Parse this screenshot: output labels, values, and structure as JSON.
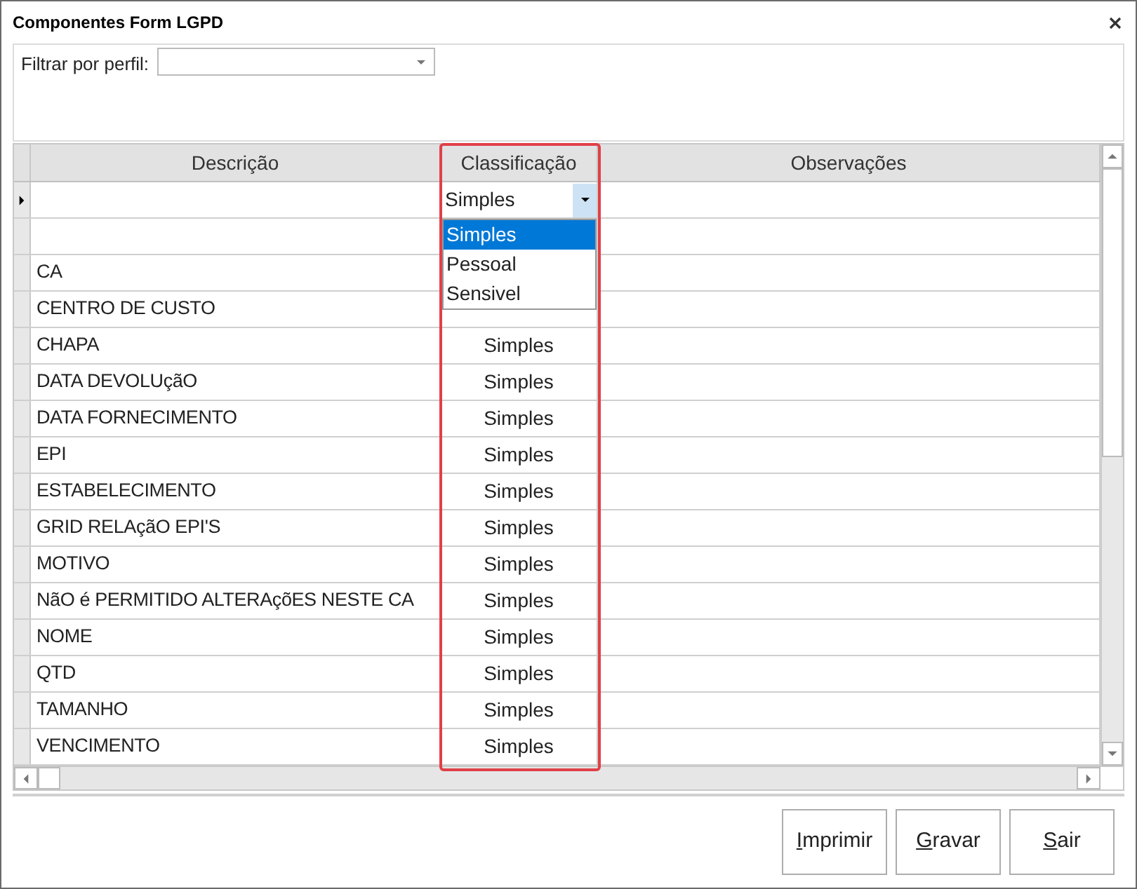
{
  "window": {
    "title": "Componentes Form LGPD"
  },
  "filter": {
    "label": "Filtrar por perfil:"
  },
  "grid": {
    "columns": [
      "Descrição",
      "Classificação",
      "Observações"
    ],
    "editor": {
      "value": "Simples",
      "expanded": true,
      "options": [
        {
          "label": "Simples",
          "selected": true
        },
        {
          "label": "Pessoal",
          "selected": false
        },
        {
          "label": "Sensivel",
          "selected": false
        }
      ]
    },
    "rows": [
      {
        "current": true
      },
      {
        "current": false
      },
      {
        "current": false,
        "descricao": "CA"
      },
      {
        "current": false,
        "descricao": "CENTRO DE CUSTO"
      },
      {
        "current": false,
        "descricao": "CHAPA",
        "classificacao": "Simples"
      },
      {
        "current": false,
        "descricao": "DATA DEVOLUçãO",
        "classificacao": "Simples"
      },
      {
        "current": false,
        "descricao": "DATA FORNECIMENTO",
        "classificacao": "Simples"
      },
      {
        "current": false,
        "descricao": "EPI",
        "classificacao": "Simples"
      },
      {
        "current": false,
        "descricao": "ESTABELECIMENTO",
        "classificacao": "Simples"
      },
      {
        "current": false,
        "descricao": "GRID RELAçãO EPI'S",
        "classificacao": "Simples"
      },
      {
        "current": false,
        "descricao": "MOTIVO",
        "classificacao": "Simples"
      },
      {
        "current": false,
        "descricao": "NãO é PERMITIDO ALTERAçõES NESTE CA",
        "classificacao": "Simples"
      },
      {
        "current": false,
        "descricao": "NOME",
        "classificacao": "Simples"
      },
      {
        "current": false,
        "descricao": "QTD",
        "classificacao": "Simples"
      },
      {
        "current": false,
        "descricao": "TAMANHO",
        "classificacao": "Simples"
      },
      {
        "current": false,
        "descricao": "VENCIMENTO",
        "classificacao": "Simples"
      }
    ],
    "highlight_column": true
  },
  "buttons": [
    {
      "label": "Imprimir",
      "access_key_underlined": true
    },
    {
      "label": "Gravar",
      "access_key_underlined": true
    },
    {
      "label": "Sair",
      "access_key_underlined": true
    }
  ]
}
